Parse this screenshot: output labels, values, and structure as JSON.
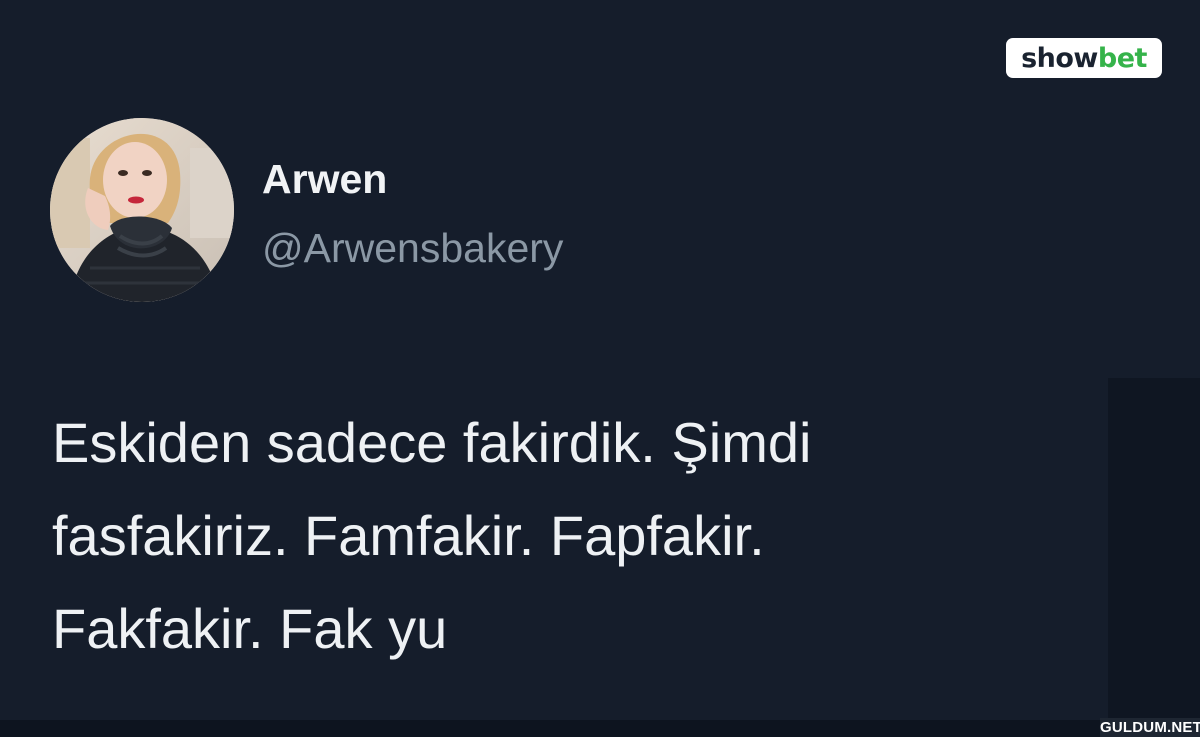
{
  "brand": {
    "logo_part1": "show",
    "logo_part2": "bet",
    "accent_color": "#35b34a"
  },
  "tweet": {
    "author": {
      "display_name": "Arwen",
      "handle": "@Arwensbakery"
    },
    "text_lines": [
      "Eskiden sadece fakirdik. Şimdi",
      "fasfakiriz. Famfakir. Fapfakir.",
      "Fakfakir. Fak yu"
    ]
  },
  "watermark": {
    "text": "GULDUM.NET"
  },
  "theme": {
    "background": "#151d2b",
    "primary_text": "#eef1f4",
    "secondary_text": "#8b98a5"
  }
}
